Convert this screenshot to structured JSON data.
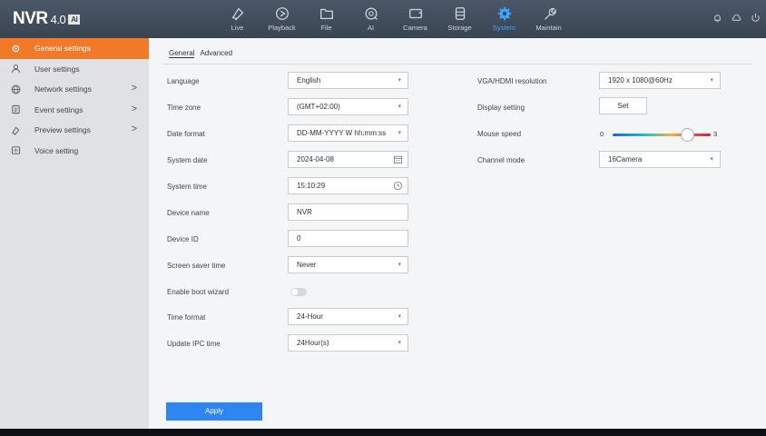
{
  "app": {
    "brand": "NVR",
    "version": "4.0",
    "ai_badge": "AI"
  },
  "nav": [
    {
      "label": "Live",
      "icon": "live-icon"
    },
    {
      "label": "Playback",
      "icon": "playback-icon"
    },
    {
      "label": "File",
      "icon": "folder-icon"
    },
    {
      "label": "AI",
      "icon": "ai-icon"
    },
    {
      "label": "Camera",
      "icon": "camera-icon"
    },
    {
      "label": "Storage",
      "icon": "storage-icon"
    },
    {
      "label": "System",
      "icon": "gear-icon",
      "active": true
    },
    {
      "label": "Maintain",
      "icon": "wrench-icon"
    }
  ],
  "sidebar": {
    "items": [
      {
        "label": "General settings",
        "icon": "gear-icon",
        "active": true
      },
      {
        "label": "User settings",
        "icon": "user-icon"
      },
      {
        "label": "Network settings",
        "icon": "globe-icon",
        "chevron": ">"
      },
      {
        "label": "Event settings",
        "icon": "event-icon",
        "chevron": ">"
      },
      {
        "label": "Preview settings",
        "icon": "preview-icon",
        "chevron": ">"
      },
      {
        "label": "Voice setting",
        "icon": "voice-icon"
      }
    ]
  },
  "tabs": {
    "general": "General",
    "advanced": "Advanced"
  },
  "form": {
    "language": {
      "label": "Language",
      "value": "English"
    },
    "time_zone": {
      "label": "Time zone",
      "value": "(GMT+02:00)"
    },
    "date_format": {
      "label": "Date format",
      "value": "DD-MM-YYYY W hh:mm:ss"
    },
    "system_date": {
      "label": "System date",
      "value": "2024-04-08"
    },
    "system_time": {
      "label": "System time",
      "value": "15:10:29"
    },
    "device_name": {
      "label": "Device name",
      "value": "NVR"
    },
    "device_id": {
      "label": "Device ID",
      "value": "0"
    },
    "screen_saver": {
      "label": "Screen saver time",
      "value": "Never"
    },
    "boot_wizard": {
      "label": "Enable boot wizard",
      "enabled": false
    },
    "time_format": {
      "label": "Time format",
      "value": "24-Hour"
    },
    "update_ipc": {
      "label": "Update IPC time",
      "value": "24Hour(s)"
    }
  },
  "right": {
    "resolution": {
      "label": "VGA/HDMI resolution",
      "value": "1920 x 1080@60Hz"
    },
    "display": {
      "label": "Display setting",
      "button": "Set"
    },
    "mouse_speed": {
      "label": "Mouse speed",
      "min": "0",
      "max": "3",
      "value": 2.3
    },
    "channel_mode": {
      "label": "Channel mode",
      "value": "16Camera"
    }
  },
  "apply_label": "Apply",
  "colors": {
    "accent": "#f07a28",
    "active_nav": "#3ea4ff",
    "apply": "#2f86f2"
  }
}
